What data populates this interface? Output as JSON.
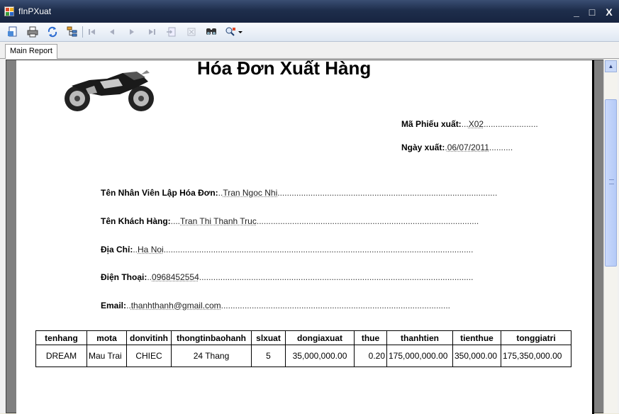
{
  "window": {
    "title": "fInPXuat"
  },
  "window_controls": {
    "minimize": "_",
    "maximize": "□",
    "close": "X"
  },
  "tabs": [
    {
      "label": "Main Report"
    }
  ],
  "report": {
    "title": "Hóa Đơn Xuất Hàng",
    "ma_phieu_label": "Mã Phiếu xuất:",
    "ma_phieu_value": "X02",
    "ngay_label": "Ngày xuất:",
    "ngay_value": "06/07/2011",
    "nhanvien_label": "Tên Nhân Viên Lập Hóa Đơn:",
    "nhanvien_value": "Tran Ngoc Nhi",
    "khachhang_label": "Tên Khách Hàng:",
    "khachhang_value": "Tran Thi Thanh Truc",
    "diachi_label": "Địa Chỉ:",
    "diachi_value": "Ha Noi",
    "dienthoai_label": "Điện Thoại:",
    "dienthoai_value": "0968452554",
    "email_label": "Email:",
    "email_value": "thanhthanh@gmail.com",
    "table": {
      "headers": [
        "tenhang",
        "mota",
        "donvitinh",
        "thongtinbaohanh",
        "slxuat",
        "dongiaxuat",
        "thue",
        "thanhtien",
        "tienthue",
        "tonggiatri"
      ],
      "rows": [
        [
          "DREAM",
          "Mau Trai",
          "CHIEC",
          "24 Thang",
          "5",
          "35,000,000.00",
          "0.20",
          "175,000,000.00",
          "350,000.00",
          "175,350,000.00"
        ]
      ]
    }
  }
}
